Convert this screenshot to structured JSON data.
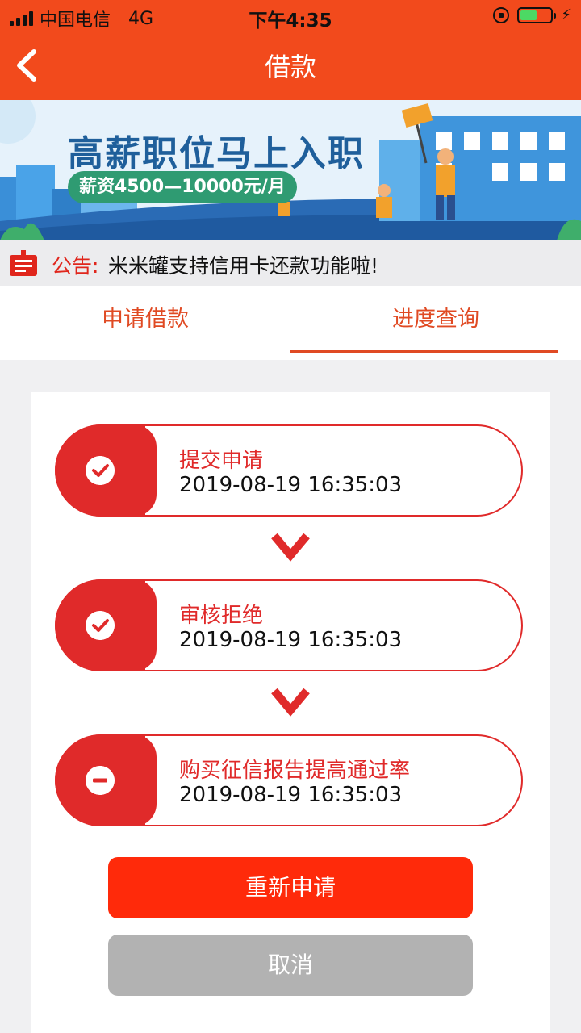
{
  "status_bar": {
    "carrier": "中国电信",
    "network": "4G",
    "time": "下午4:35"
  },
  "nav": {
    "title": "借款"
  },
  "banner": {
    "title": "高薪职位马上入职",
    "salary": "薪资4500—10000元/月"
  },
  "notice": {
    "label": "公告:",
    "text": "米米罐支持信用卡还款功能啦!"
  },
  "tabs": [
    {
      "label": "申请借款",
      "active": false
    },
    {
      "label": "进度查询",
      "active": true
    }
  ],
  "steps": [
    {
      "title": "提交申请",
      "time": "2019-08-19 16:35:03",
      "icon": "check-icon"
    },
    {
      "title": "审核拒绝",
      "time": "2019-08-19 16:35:03",
      "icon": "check-icon"
    },
    {
      "title": "购买征信报告提高通过率",
      "time": "2019-08-19 16:35:03",
      "icon": "minus-icon"
    }
  ],
  "buttons": {
    "reapply": "重新申请",
    "cancel": "取消"
  },
  "colors": {
    "header": "#f24a1c",
    "accent_red": "#e02a2a",
    "primary_button": "#ff2a0a",
    "secondary_button": "#b2b2b2",
    "tab_accent": "#e04a23"
  }
}
